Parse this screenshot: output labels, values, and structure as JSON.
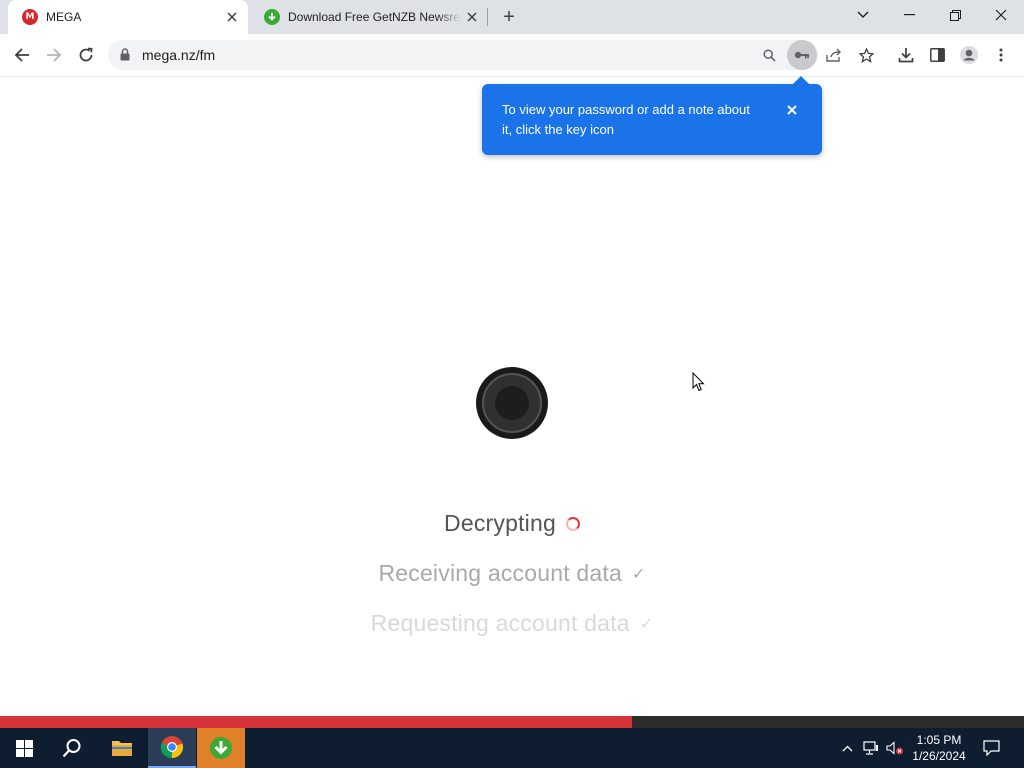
{
  "browser": {
    "tabs": [
      {
        "title": "MEGA",
        "favicon": "mega-logo-icon",
        "active": true
      },
      {
        "title": "Download Free GetNZB Newsreader",
        "favicon": "green-download-icon",
        "active": false
      }
    ],
    "favicon_mega_letter": "M",
    "new_tab_symbol": "+",
    "close_symbol": "✕",
    "url": "mega.nz/fm",
    "colors": {
      "tabstrip": "#dee1e6",
      "accent_blue": "#1a73e8"
    }
  },
  "tooltip": {
    "text": "To view your password or add a note about it, click the key icon"
  },
  "content": {
    "steps": [
      {
        "label": "Decrypting",
        "status": "in-progress"
      },
      {
        "label": "Receiving account data",
        "status": "done",
        "mark": "✓"
      },
      {
        "label": "Requesting account data",
        "status": "done",
        "mark": "✓"
      }
    ],
    "progress_fraction": 0.617,
    "colors": {
      "progress": "#d63239",
      "spinner": "#e53935"
    }
  },
  "taskbar": {
    "time": "1:05 PM",
    "date": "1/26/2024",
    "pinned": [
      "windows-start-icon",
      "search-icon",
      "file-explorer-icon",
      "chrome-icon",
      "getnzb-icon"
    ]
  }
}
